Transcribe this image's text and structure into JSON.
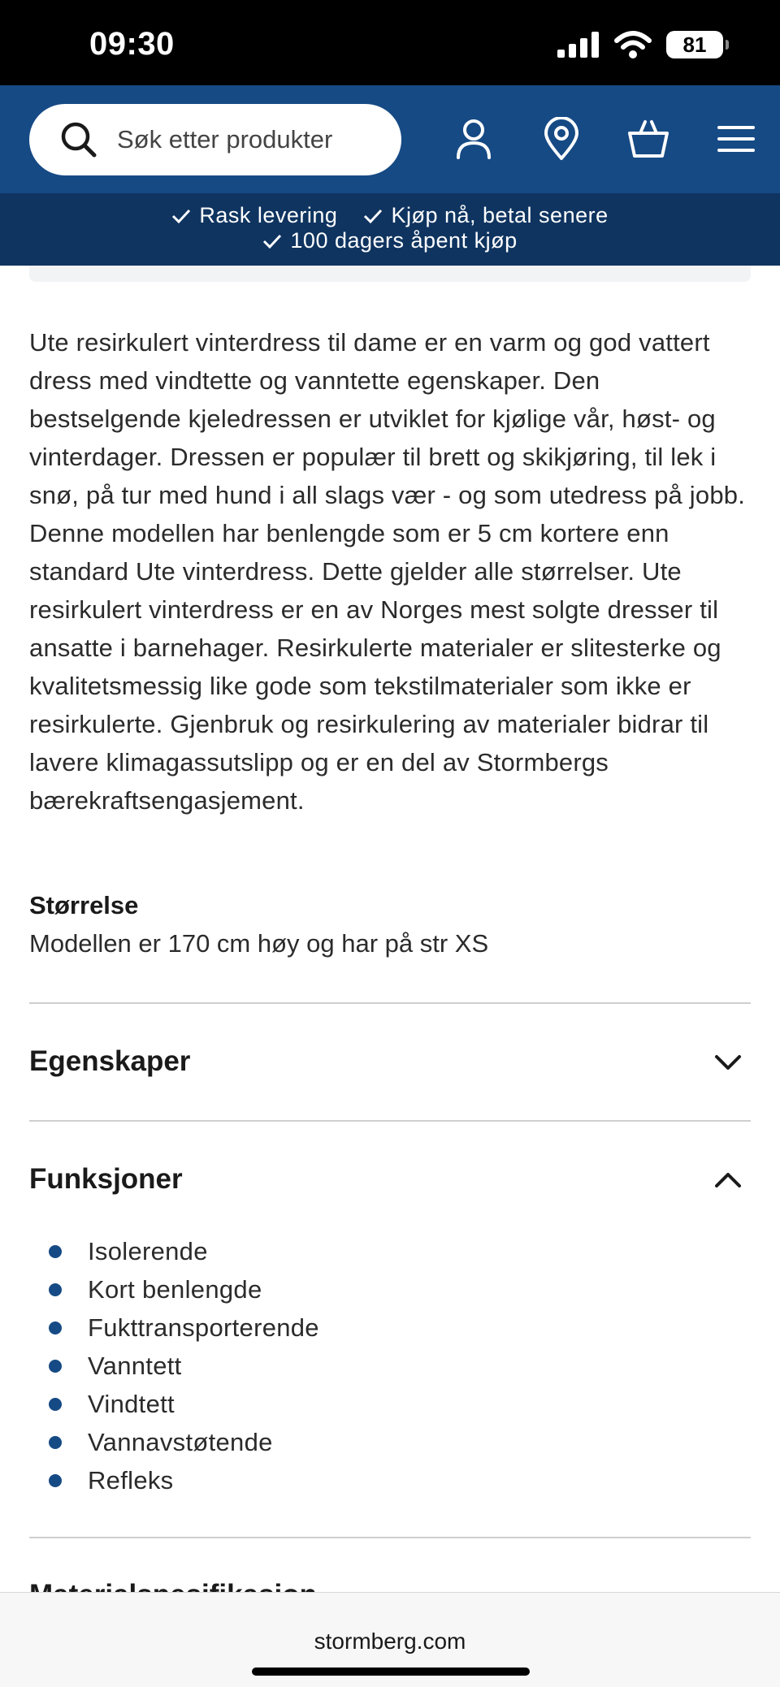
{
  "status_bar": {
    "time": "09:30",
    "battery": "81"
  },
  "header": {
    "search_placeholder": "Søk etter produkter",
    "icons": [
      "search-icon",
      "user-icon",
      "location-pin-icon",
      "shopping-bag-icon",
      "menu-icon"
    ],
    "brand_color": "#164a85"
  },
  "usp": {
    "items": [
      "Rask levering",
      "Kjøp nå, betal senere",
      "100 dagers åpent kjøp"
    ],
    "color": "#0f3460"
  },
  "product": {
    "description": "Ute resirkulert vinterdress til dame er en varm og god vattert dress med vindtette og vanntette egenskaper. Den bestselgende kjeledressen er utviklet for kjølige vår, høst- og vinterdager. Dressen er populær til brett og skikjøring, til lek i snø, på tur med hund i all slags vær - og som utedress på jobb. Denne modellen har benlengde som er 5 cm kortere enn standard Ute vinterdress. Dette gjelder alle størrelser. Ute resirkulert vinterdress er en av Norges mest solgte dresser til ansatte i barnehager. Resirkulerte materialer er slitesterke og kvalitetsmessig like gode som tekstilmaterialer som ikke er resirkulerte. Gjenbruk og resirkulering av materialer bidrar til lavere klimagassutslipp og er en del av Stormbergs bærekraftsengasjement.",
    "size_title": "Størrelse",
    "size_text": "Modellen er 170 cm høy og har på str XS"
  },
  "accordions": [
    {
      "title": "Egenskaper",
      "expanded": false
    },
    {
      "title": "Funksjoner",
      "expanded": true,
      "items": [
        "Isolerende",
        "Kort benlengde",
        "Fukttransporterende",
        "Vanntett",
        "Vindtett",
        "Vannavstøtende",
        "Refleks"
      ]
    },
    {
      "title": "Materialspesifikasjon",
      "expanded": false
    }
  ],
  "browser": {
    "url": "stormberg.com"
  }
}
